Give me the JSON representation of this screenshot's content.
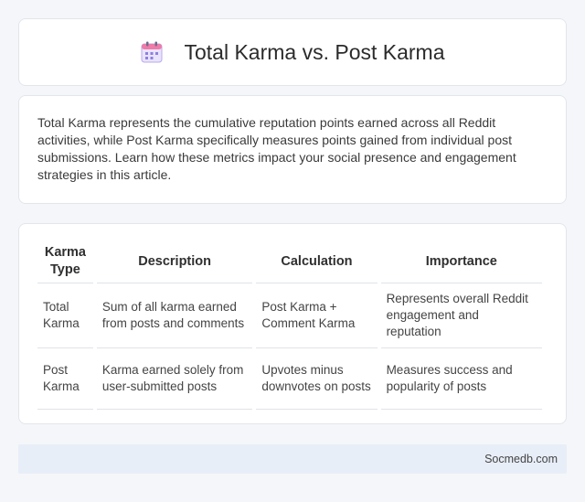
{
  "header": {
    "title": "Total Karma vs. Post Karma",
    "icon": "calendar-icon"
  },
  "intro": {
    "text": "Total Karma represents the cumulative reputation points earned across all Reddit activities, while Post Karma specifically measures points gained from individual post submissions. Learn how these metrics impact your social presence and engagement strategies in this article."
  },
  "table": {
    "headers": [
      "Karma Type",
      "Description",
      "Calculation",
      "Importance"
    ],
    "rows": [
      [
        "Total Karma",
        "Sum of all karma earned from posts and comments",
        "Post Karma + Comment Karma",
        "Represents overall Reddit engagement and reputation"
      ],
      [
        "Post Karma",
        "Karma earned solely from user-submitted posts",
        "Upvotes minus downvotes on posts",
        "Measures success and popularity of posts"
      ]
    ]
  },
  "footer": {
    "brand": "Socmedb.com"
  }
}
